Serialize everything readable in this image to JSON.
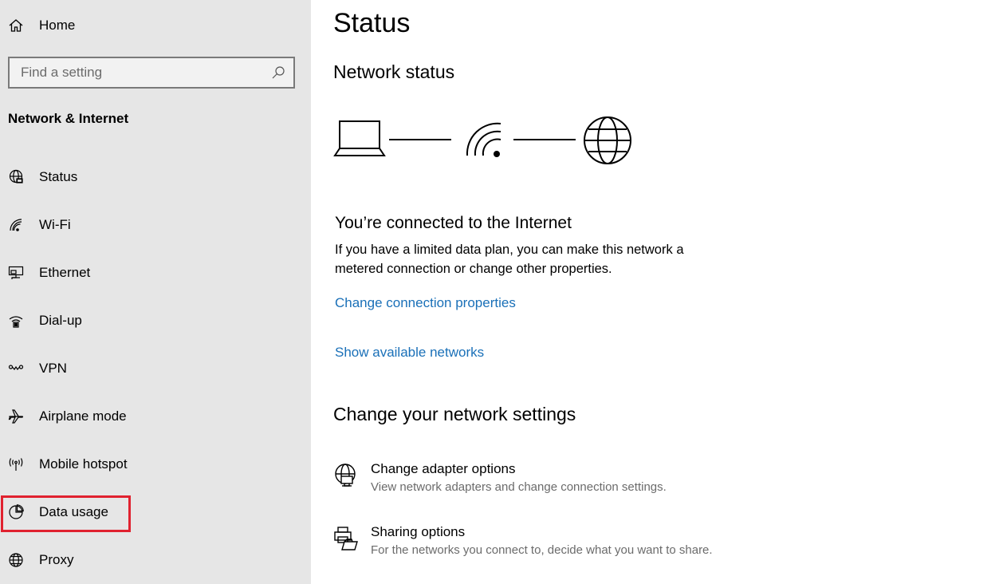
{
  "sidebar": {
    "home_label": "Home",
    "search": {
      "placeholder": "Find a setting"
    },
    "section_title": "Network & Internet",
    "items": [
      {
        "label": "Status",
        "icon": "globe-icon"
      },
      {
        "label": "Wi-Fi",
        "icon": "wifi-icon"
      },
      {
        "label": "Ethernet",
        "icon": "ethernet-icon"
      },
      {
        "label": "Dial-up",
        "icon": "dialup-icon"
      },
      {
        "label": "VPN",
        "icon": "vpn-icon"
      },
      {
        "label": "Airplane mode",
        "icon": "airplane-icon"
      },
      {
        "label": "Mobile hotspot",
        "icon": "hotspot-icon"
      },
      {
        "label": "Data usage",
        "icon": "pie-chart-icon"
      },
      {
        "label": "Proxy",
        "icon": "globe-icon"
      }
    ],
    "highlighted_item": "Data usage",
    "highlight_color": "#e0222f"
  },
  "main": {
    "title": "Status",
    "network_status_heading": "Network status",
    "diagram_icons": [
      "laptop-icon",
      "wifi-icon",
      "globe-icon"
    ],
    "connected_heading": "You’re connected to the Internet",
    "connected_desc": "If you have a limited data plan, you can make this network a metered connection or change other properties.",
    "links": {
      "change_properties": "Change connection properties",
      "show_networks": "Show available networks"
    },
    "change_settings_heading": "Change your network settings",
    "options": [
      {
        "title": "Change adapter options",
        "desc": "View network adapters and change connection settings.",
        "icon": "adapter-icon"
      },
      {
        "title": "Sharing options",
        "desc": "For the networks you connect to, decide what you want to share.",
        "icon": "sharing-icon"
      }
    ]
  },
  "colors": {
    "sidebar_bg": "#e6e6e6",
    "link": "#1a70b8",
    "secondary_text": "#6b6b6b"
  }
}
